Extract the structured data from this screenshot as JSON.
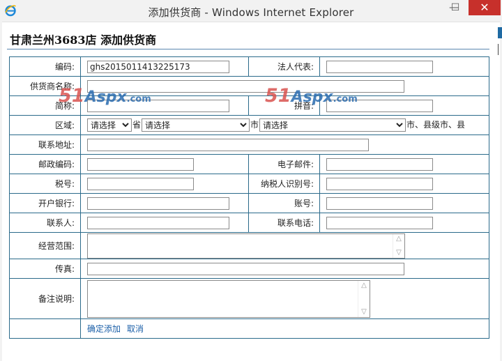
{
  "window": {
    "title": "添加供货商 - Windows Internet Explorer",
    "minimize": "—",
    "maximize": "☐",
    "close": "✕"
  },
  "page": {
    "title": "甘肃兰州3683店 添加供货商"
  },
  "form": {
    "code_label": "编码:",
    "code_value": "ghs2015011413225173",
    "legal_rep_label": "法人代表:",
    "supplier_name_label": "供货商名称:",
    "short_name_label": "简称:",
    "pinyin_label": "拼音:",
    "region_label": "区域:",
    "province_select": "请选择",
    "province_unit": "省",
    "city_select": "请选择",
    "city_unit": "市",
    "county_select": "请选择",
    "county_unit": "市、县级市、县",
    "address_label": "联系地址:",
    "postcode_label": "邮政编码:",
    "email_label": "电子邮件:",
    "tax_no_label": "税号:",
    "taxpayer_id_label": "纳税人识别号:",
    "bank_label": "开户银行:",
    "account_label": "账号:",
    "contact_label": "联系人:",
    "phone_label": "联系电话:",
    "scope_label": "经营范围:",
    "fax_label": "传真:",
    "remark_label": "备注说明:"
  },
  "actions": {
    "confirm": "确定添加",
    "cancel": "取消"
  },
  "watermark": {
    "num": "51",
    "brand": "Aspx",
    "domain": ".com"
  }
}
